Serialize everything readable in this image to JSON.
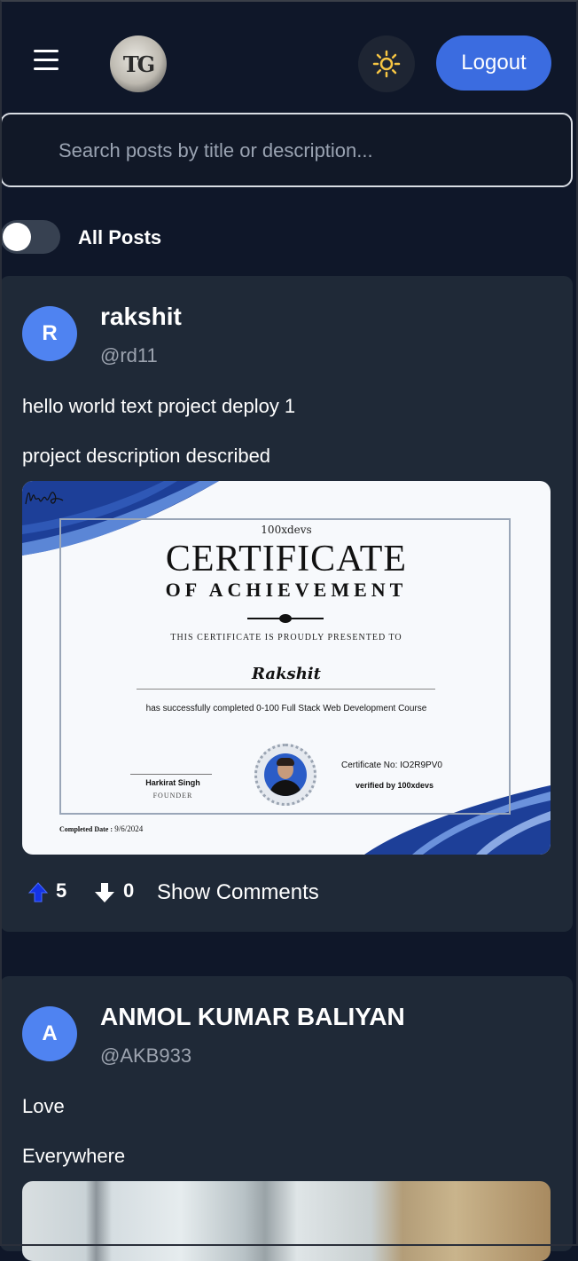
{
  "header": {
    "menu_icon": "hamburger-menu-icon",
    "logo_text": "TG",
    "theme_icon": "sun-icon",
    "theme_color": "#f6c543",
    "logout_label": "Logout",
    "accent": "#3b6ce0"
  },
  "search": {
    "placeholder": "Search posts by title or description...",
    "value": ""
  },
  "filter": {
    "toggle_on": false,
    "label": "All Posts"
  },
  "posts": [
    {
      "avatar_initial": "R",
      "author": "rakshit",
      "handle": "@rd11",
      "title": "hello world text project deploy 1",
      "description": "project description described",
      "certificate": {
        "brand": "100xdevs",
        "title": "CERTIFICATE",
        "subtitle": "OF ACHIEVEMENT",
        "presented": "THIS CERTIFICATE IS PROUDLY PRESENTED TO",
        "recipient": "Rakshit",
        "course": "has successfully completed 0-100 Full Stack Web Development Course",
        "signer": "Harkirat Singh",
        "signer_role": "FOUNDER",
        "cert_no": "Certificate No: IO2R9PV0",
        "verified": "verified by 100xdevs",
        "completed_label": "Completed Date :",
        "completed_date": "9/6/2024"
      },
      "upvotes": "5",
      "downvotes": "0",
      "comments_label": "Show Comments"
    },
    {
      "avatar_initial": "A",
      "author": "ANMOL KUMAR BALIYAN",
      "handle": "@AKB933",
      "title": "Love",
      "description": "Everywhere"
    }
  ]
}
